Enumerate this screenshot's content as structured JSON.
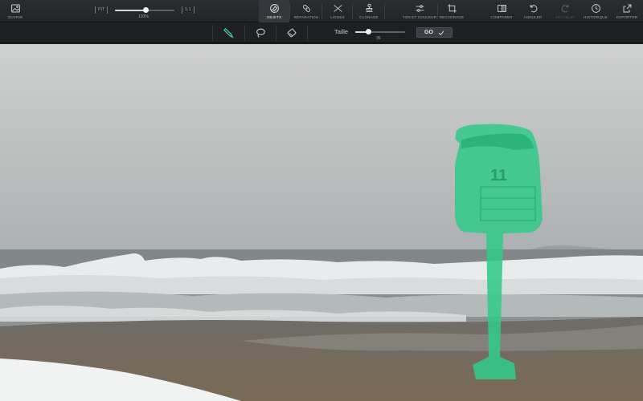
{
  "toolbar": {
    "open": "OUVRIR",
    "zoom": {
      "fit": "FIT",
      "one_to_one": "1:1",
      "value": "103%",
      "level": 0.52
    },
    "tools": [
      {
        "label": "OBJETS",
        "active": true
      },
      {
        "label": "RÉPARATION",
        "active": false
      },
      {
        "label": "LIGNES",
        "active": false
      },
      {
        "label": "CLONAGE",
        "active": false
      },
      {
        "label": "TON ET COULEUR",
        "active": false
      },
      {
        "label": "RECADRAGE",
        "active": false
      }
    ],
    "compare": "COMPARER",
    "undo": "ANNULER",
    "redo": "RÉTABLIR",
    "history": "HISTORIQUE",
    "export": "EXPORTER"
  },
  "subbar": {
    "tools": [
      "brush-tool",
      "lasso-tool",
      "eraser-tool"
    ],
    "active_tool": "brush-tool",
    "size_label": "Taille",
    "size_value": "35",
    "size_level": 0.27,
    "go_label": "GO"
  },
  "colors": {
    "accent": "#3ee6a2",
    "selection_mask": "#33c98a",
    "toolbar_bg": "#2b2d31",
    "subbar_bg": "#1f2023"
  }
}
